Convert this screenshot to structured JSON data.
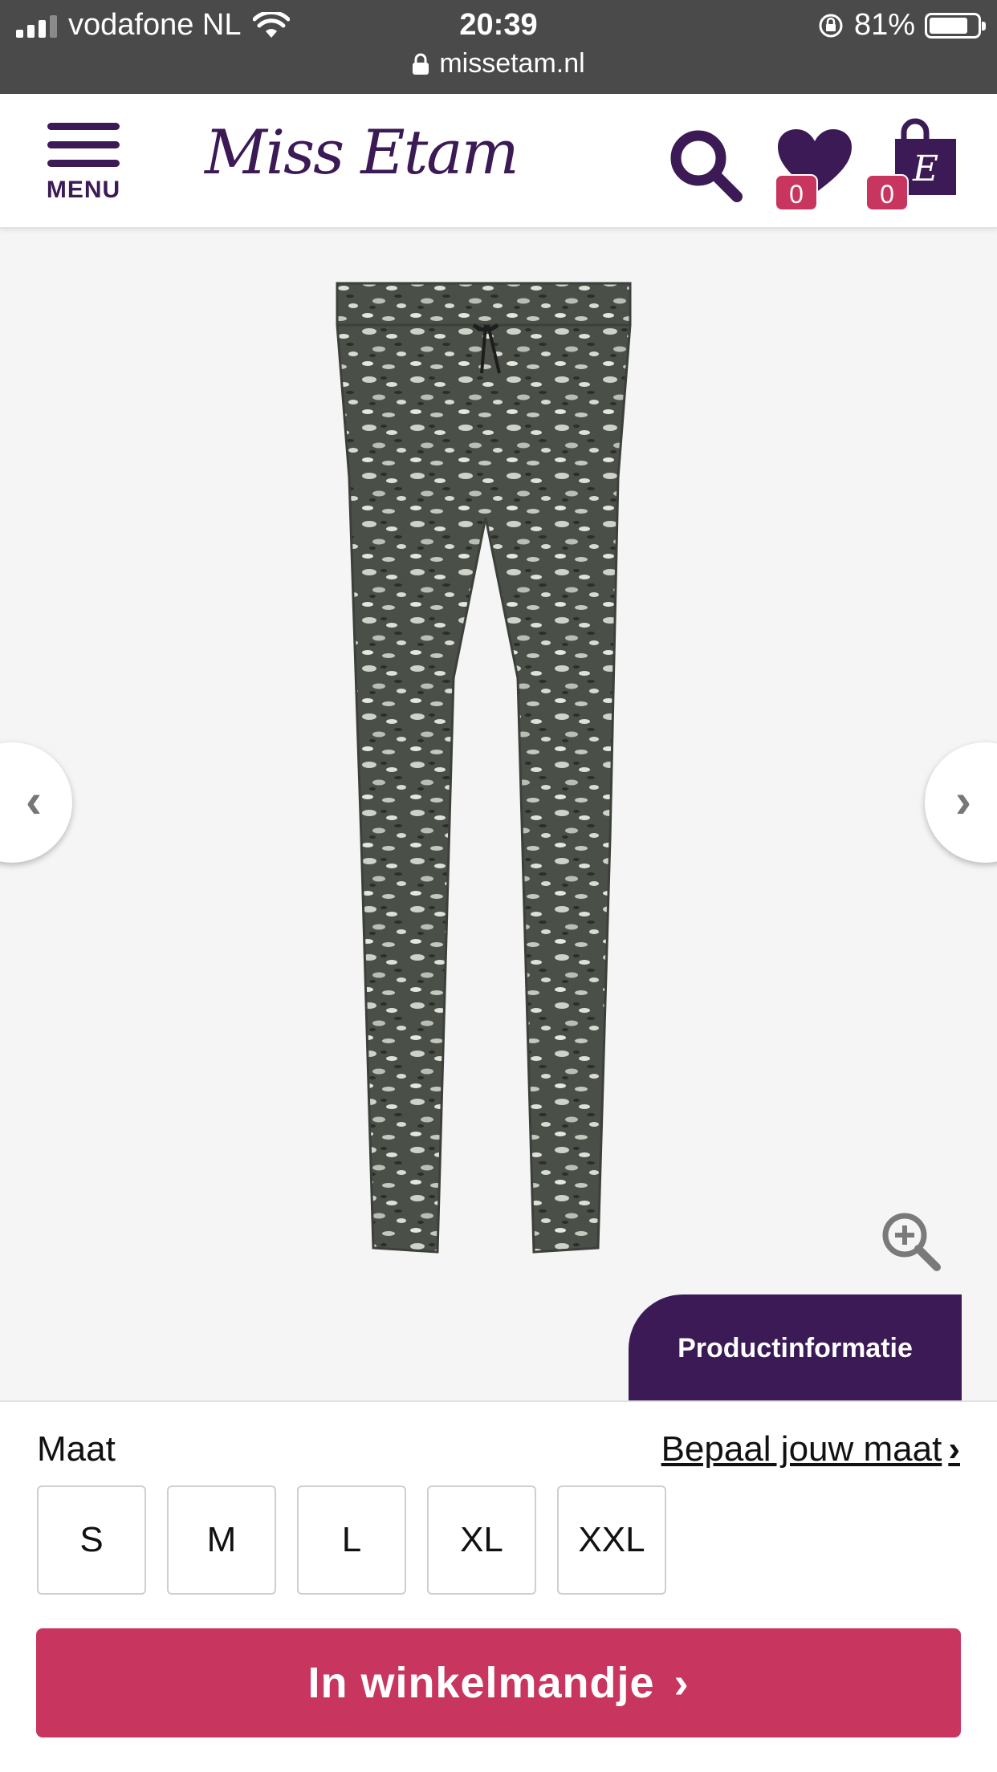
{
  "status_bar": {
    "carrier": "vodafone NL",
    "time": "20:39",
    "battery": "81%",
    "battery_level": 0.81,
    "url": "missetam.nl"
  },
  "header": {
    "menu_label": "MENU",
    "logo_text": "Miss Etam",
    "wishlist_count": "0",
    "cart_count": "0",
    "bag_letter": "E"
  },
  "gallery": {
    "prev_icon": "chevron-left-icon",
    "next_icon": "chevron-right-icon",
    "zoom_icon": "zoom-in-icon",
    "info_button": "Productinformatie"
  },
  "size_selector": {
    "label": "Maat",
    "guide_link": "Bepaal jouw maat",
    "sizes": [
      "S",
      "M",
      "L",
      "XL",
      "XXL"
    ]
  },
  "cart": {
    "button_label": "In winkelmandje"
  },
  "colors": {
    "brand_purple": "#3b1a56",
    "accent_pink": "#c8365f"
  }
}
